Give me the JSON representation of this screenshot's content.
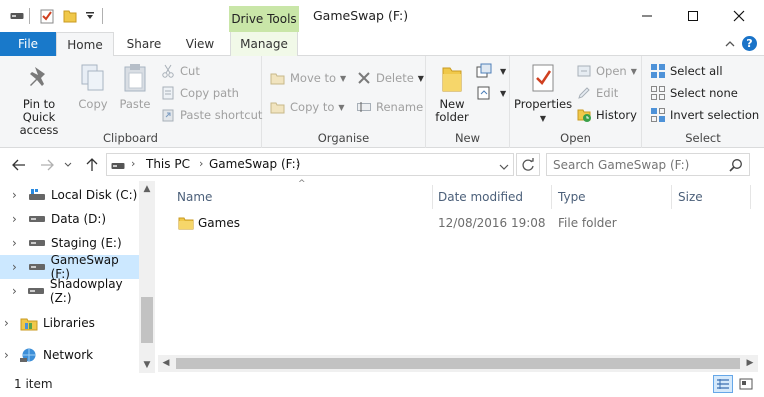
{
  "titlebar": {
    "context_tab": "Drive Tools",
    "window_title": "GameSwap (F:)",
    "quick_access": [
      "drive-icon",
      "properties-check-icon",
      "new-folder-icon",
      "customize-dropdown-icon"
    ]
  },
  "tabs": {
    "file": "File",
    "home": "Home",
    "share": "Share",
    "view": "View",
    "manage": "Manage",
    "help": "?"
  },
  "ribbon": {
    "clipboard": {
      "label": "Clipboard",
      "pin": "Pin to Quick access",
      "copy": "Copy",
      "paste": "Paste",
      "cut": "Cut",
      "copy_path": "Copy path",
      "paste_shortcut": "Paste shortcut"
    },
    "organise": {
      "label": "Organise",
      "move_to": "Move to",
      "copy_to": "Copy to",
      "delete": "Delete",
      "rename": "Rename"
    },
    "new": {
      "label": "New",
      "new_folder_line1": "New",
      "new_folder_line2": "folder"
    },
    "open": {
      "label": "Open",
      "properties": "Properties",
      "open": "Open",
      "edit": "Edit",
      "history": "History"
    },
    "select": {
      "label": "Select",
      "select_all": "Select all",
      "select_none": "Select none",
      "invert": "Invert selection"
    }
  },
  "address": {
    "crumbs": [
      "This PC",
      "GameSwap (F:)"
    ],
    "search_placeholder": "Search GameSwap (F:)"
  },
  "nav": {
    "items": [
      {
        "label": "Local Disk (C:)"
      },
      {
        "label": "Data (D:)"
      },
      {
        "label": "Staging (E:)"
      },
      {
        "label": "GameSwap (F:)"
      },
      {
        "label": "Shadowplay (Z:)"
      },
      {
        "label": "Libraries"
      },
      {
        "label": "Network"
      }
    ]
  },
  "files": {
    "columns": [
      "Name",
      "Date modified",
      "Type",
      "Size"
    ],
    "rows": [
      {
        "name": "Games",
        "date": "12/08/2016 19:08",
        "type": "File folder",
        "size": ""
      }
    ]
  },
  "status": {
    "count": "1 item"
  },
  "colors": {
    "file_tab": "#1979ca",
    "context_tab": "#c9e6a8",
    "selection": "#cce8ff",
    "folder": "#f0c84a"
  }
}
